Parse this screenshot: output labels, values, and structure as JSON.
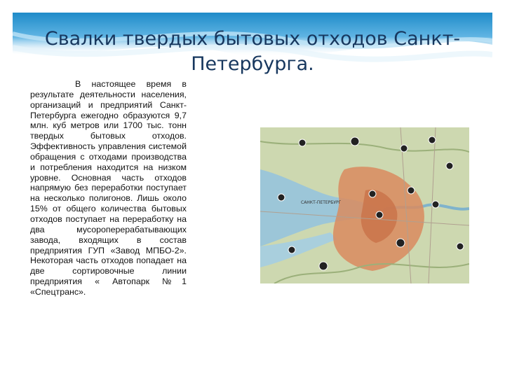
{
  "slide": {
    "title": "Свалки твердых бытовых отходов Санкт-Петербурга.",
    "body": "В настоящее время в результате деятельности населения, организаций и предприятий Санкт-Петербурга ежегодно образуются 9,7 млн. куб метров или 1700 тыс. тонн твердых бытовых отходов. Эффективность управления системой обращения с отходами производства и потребления находится на низком уровне. Основная часть отходов напрямую без переработки поступает на несколько полигонов. Лишь около 15% от общего количества бытовых отходов поступает на переработку на два мусороперерабатывающих завода, входящих в состав предприятия ГУП «Завод МПБО-2». Некоторая часть отходов попадает на две сортировочные линии предприятия « Автопарк №1 «Спецтранс».",
    "map_label": "САНКТ-ПЕТЕРБУРГ"
  },
  "colors": {
    "title": "#17375e",
    "band_dark": "#1f8bc9",
    "band_light": "#bfe3f6",
    "water": "#9cc6d8",
    "land": "#cdd8b0",
    "city": "#d98b5f"
  }
}
